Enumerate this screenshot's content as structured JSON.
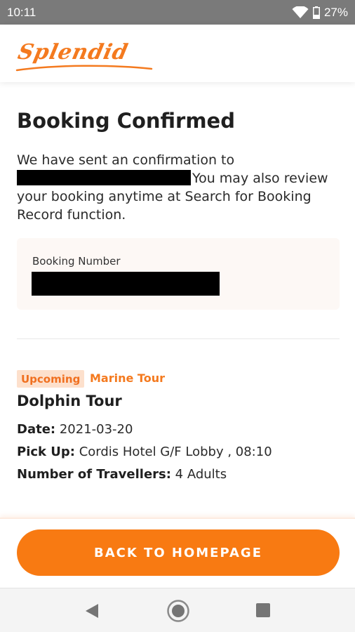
{
  "status_bar": {
    "time": "10:11",
    "battery": "27%",
    "icons": [
      "wifi-icon",
      "battery-icon"
    ]
  },
  "header": {
    "logo_text": "Splendid",
    "brand_color": "#f47a1f"
  },
  "main": {
    "title": "Booking Confirmed",
    "message_prefix": "We have sent an confirmation to",
    "message_suffix": "You may also review your booking anytime at Search for Booking Record function.",
    "booking_card": {
      "label": "Booking Number"
    },
    "tour": {
      "status_badge": "Upcoming",
      "category": "Marine Tour",
      "name": "Dolphin Tour",
      "date_label": "Date:",
      "date_value": "2021-03-20",
      "pickup_label": "Pick Up:",
      "pickup_value": "Cordis Hotel G/F Lobby , 08:10",
      "travellers_label": "Number of Travellers:",
      "travellers_value": "4 Adults"
    }
  },
  "footer": {
    "home_button_label": "BACK TO HOMEPAGE",
    "button_color": "#f87a12"
  },
  "nav_bar": {
    "icons": [
      "back-icon",
      "home-icon",
      "recents-icon"
    ]
  }
}
